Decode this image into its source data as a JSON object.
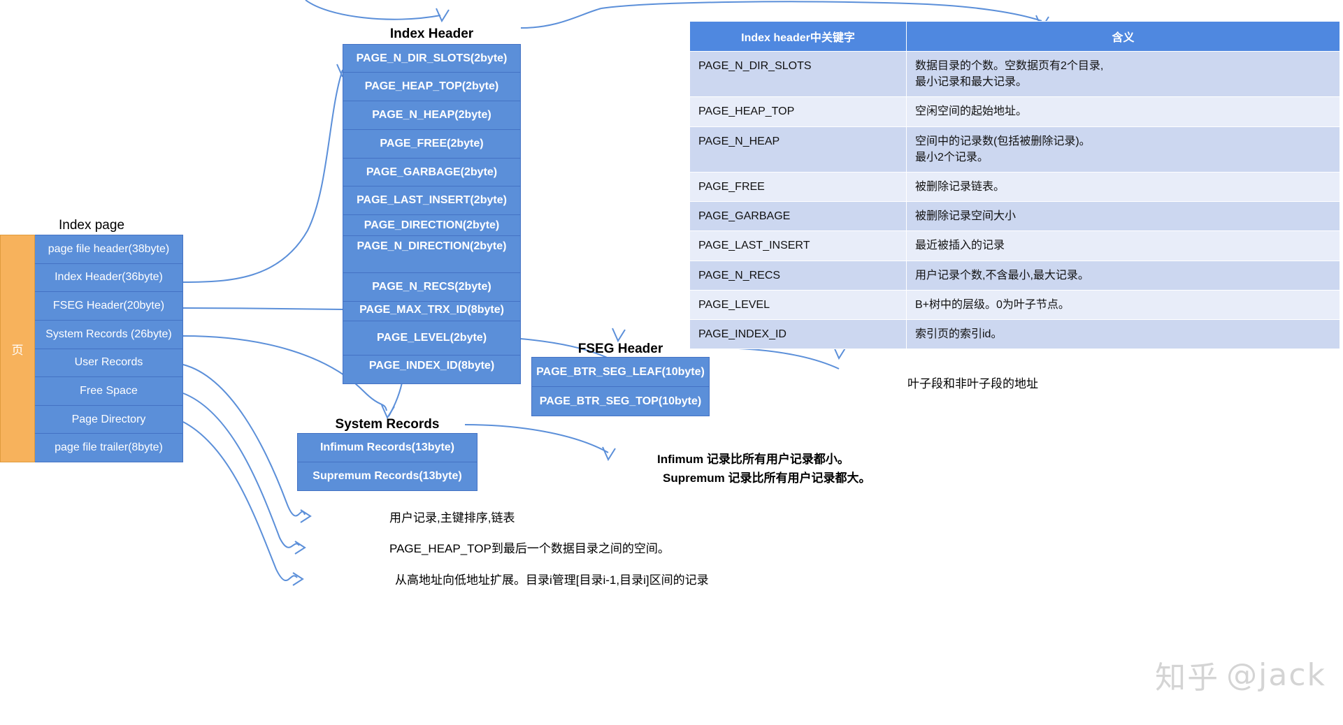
{
  "index_page": {
    "title": "Index page",
    "side_label": "页",
    "rows": [
      "page file header(38byte)",
      "Index Header(36byte)",
      "FSEG Header(20byte)",
      "System Records (26byte)",
      "User Records",
      "Free Space",
      "Page Directory",
      "page file trailer(8byte)"
    ]
  },
  "index_header": {
    "title": "Index Header",
    "rows": [
      "PAGE_N_DIR_SLOTS(2byte)",
      "PAGE_HEAP_TOP(2byte)",
      "PAGE_N_HEAP(2byte)",
      "PAGE_FREE(2byte)",
      "PAGE_GARBAGE(2byte)",
      "PAGE_LAST_INSERT(2byte)",
      "PAGE_DIRECTION(2byte)",
      "PAGE_N_DIRECTION(2byte)",
      "PAGE_N_RECS(2byte)",
      "PAGE_MAX_TRX_ID(8byte)",
      "PAGE_LEVEL(2byte)",
      "PAGE_INDEX_ID(8byte)"
    ]
  },
  "fseg_header": {
    "title": "FSEG Header",
    "rows": [
      "PAGE_BTR_SEG_LEAF(10byte)",
      "PAGE_BTR_SEG_TOP(10byte)"
    ]
  },
  "system_records": {
    "title": "System Records",
    "rows": [
      "Infimum Records(13byte)",
      "Supremum Records(13byte)"
    ]
  },
  "keyword_table": {
    "headers": [
      "Index header中关键字",
      "含义"
    ],
    "rows": [
      {
        "key": "PAGE_N_DIR_SLOTS",
        "meaning": "数据目录的个数。空数据页有2个目录,\n最小记录和最大记录。"
      },
      {
        "key": "PAGE_HEAP_TOP",
        "meaning": "空闲空间的起始地址。"
      },
      {
        "key": "PAGE_N_HEAP",
        "meaning": "空间中的记录数(包括被删除记录)。\n最小2个记录。"
      },
      {
        "key": "PAGE_FREE",
        "meaning": "被删除记录链表。"
      },
      {
        "key": "PAGE_GARBAGE",
        "meaning": "被删除记录空间大小"
      },
      {
        "key": "PAGE_LAST_INSERT",
        "meaning": "最近被插入的记录"
      },
      {
        "key": "PAGE_N_RECS",
        "meaning": "用户记录个数,不含最小,最大记录。"
      },
      {
        "key": "PAGE_LEVEL",
        "meaning": "B+树中的层级。0为叶子节点。"
      },
      {
        "key": "PAGE_INDEX_ID",
        "meaning": "索引页的索引id。"
      }
    ]
  },
  "notes": {
    "fseg_desc": "叶子段和非叶子段的地址",
    "infimum_supremum_line1": "Infimum 记录比所有用户记录都小。",
    "infimum_supremum_line2": "Supremum 记录比所有用户记录都大。",
    "user_records": "用户记录,主键排序,链表",
    "free_space": "PAGE_HEAP_TOP到最后一个数据目录之间的空间。",
    "page_directory": "从高地址向低地址扩展。目录i管理[目录i-1,目录i]区间的记录"
  },
  "watermark": {
    "logo": "知乎",
    "handle": "@jack"
  },
  "colors": {
    "cell_blue": "#5b8fd9",
    "cell_border": "#4472c4",
    "side_orange": "#f7b25c",
    "table_header": "#4f88e0",
    "table_row_odd": "#ccd7f0",
    "table_row_even": "#e8edf9",
    "connector": "#5b8fd9"
  }
}
